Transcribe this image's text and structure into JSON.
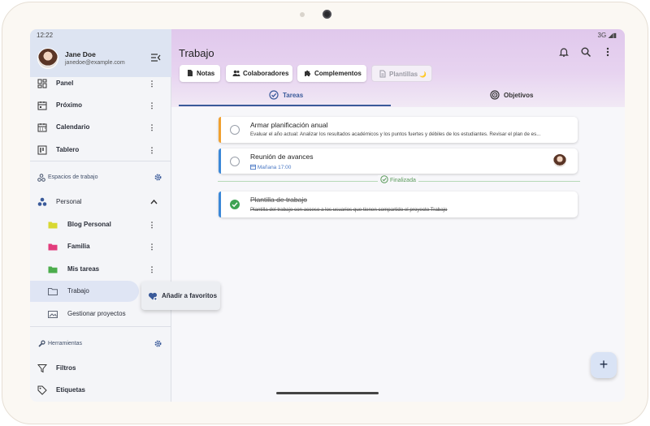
{
  "status_bar": {
    "time": "12:22",
    "network": "3G"
  },
  "user": {
    "name": "Jane Doe",
    "email": "janedoe@example.com"
  },
  "sidebar": {
    "nav": [
      {
        "label": "Panel",
        "icon": "dashboard-icon"
      },
      {
        "label": "Próximo",
        "icon": "calendar-day-icon"
      },
      {
        "label": "Calendario",
        "icon": "calendar-month-icon"
      },
      {
        "label": "Tablero",
        "icon": "board-icon"
      }
    ],
    "workspaces_title": "Espacios de trabajo",
    "workspace": "Personal",
    "folders": [
      {
        "label": "Blog Personal",
        "color": "#d8d832"
      },
      {
        "label": "Familia",
        "color": "#e23c7c"
      },
      {
        "label": "Mis tareas",
        "color": "#4cad4c"
      },
      {
        "label": "Trabajo",
        "color": "#5f6675"
      },
      {
        "label": "Gestionar proyectos",
        "color": "#5f6675"
      }
    ],
    "tools_title": "Herramientas",
    "tools": [
      {
        "label": "Filtros",
        "icon": "filter-icon"
      },
      {
        "label": "Etiquetas",
        "icon": "tag-icon"
      }
    ]
  },
  "header": {
    "title": "Trabajo",
    "chips": [
      {
        "label": "Notas",
        "icon": "note-icon"
      },
      {
        "label": "Colaboradores",
        "icon": "people-icon"
      },
      {
        "label": "Complementos",
        "icon": "puzzle-icon"
      },
      {
        "label": "Plantillas",
        "icon": "template-icon",
        "badge": "🌙",
        "disabled": true
      }
    ],
    "tabs": [
      {
        "label": "Tareas",
        "active": true
      },
      {
        "label": "Objetivos",
        "active": false
      }
    ]
  },
  "tasks": [
    {
      "title": "Armar planificación anual",
      "description": "Evaluar el año actual: Analizar los resultados académicos y los puntos fuertes y débiles de los estudiantes. Revisar el plan de es...",
      "color": "#f0a030"
    },
    {
      "title": "Reunión de avances",
      "due": "Mañana 17:00",
      "color": "#3b88d8"
    }
  ],
  "completed_label": "Finalizada",
  "completed_tasks": [
    {
      "title": "Plantilla de trabajo",
      "description": "Plantilla del trabajo con acceso a los usuarios que tienen compartido el proyecto Trabajo",
      "color": "#3b88d8"
    }
  ],
  "context_menu": {
    "label": "Añadir a favoritos"
  },
  "fab_label": "+"
}
